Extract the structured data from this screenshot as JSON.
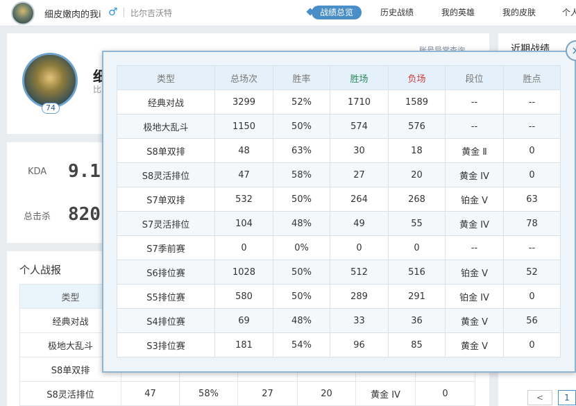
{
  "header": {
    "username": "细皮嫩肉的我i",
    "gender_symbol": "♂",
    "server": "比尔吉沃特",
    "nav": [
      "战绩总览",
      "历史战绩",
      "我的英雄",
      "我的皮肤",
      "个人"
    ]
  },
  "profile": {
    "name": "细",
    "sub": "比",
    "level": "74",
    "link": "账号异常查询"
  },
  "stats_summary": {
    "kda_label": "KDA",
    "kda_value": "9.1",
    "kills_label": "总击杀",
    "kills_value": "820"
  },
  "personal": {
    "title": "个人战报",
    "header_type": "类型",
    "rows": [
      [
        "经典对战",
        "",
        "",
        "",
        "",
        "",
        ""
      ],
      [
        "极地大乱斗",
        "",
        "",
        "",
        "",
        "",
        ""
      ],
      [
        "S8单双排",
        "",
        "",
        "",
        "",
        "",
        ""
      ],
      [
        "S8灵活排位",
        "47",
        "58%",
        "27",
        "20",
        "黄金 IV",
        "0"
      ]
    ]
  },
  "recent": {
    "title": "近期战绩"
  },
  "pager": {
    "prev": "<",
    "next": "1"
  },
  "popup": {
    "close": "×",
    "headers": [
      "类型",
      "总场次",
      "胜率",
      "胜场",
      "负场",
      "段位",
      "胜点"
    ],
    "rows": [
      [
        "经典对战",
        "3299",
        "52%",
        "1710",
        "1589",
        "--",
        "--"
      ],
      [
        "极地大乱斗",
        "1150",
        "50%",
        "574",
        "576",
        "--",
        "--"
      ],
      [
        "S8单双排",
        "48",
        "63%",
        "30",
        "18",
        "黄金 Ⅱ",
        "0"
      ],
      [
        "S8灵活排位",
        "47",
        "58%",
        "27",
        "20",
        "黄金 IV",
        "0"
      ],
      [
        "S7单双排",
        "532",
        "50%",
        "264",
        "268",
        "铂金 V",
        "63"
      ],
      [
        "S7灵活排位",
        "104",
        "48%",
        "49",
        "55",
        "黄金 IV",
        "78"
      ],
      [
        "S7季前赛",
        "0",
        "0%",
        "0",
        "0",
        "--",
        "--"
      ],
      [
        "S6排位赛",
        "1028",
        "50%",
        "512",
        "516",
        "铂金 V",
        "52"
      ],
      [
        "S5排位赛",
        "580",
        "50%",
        "289",
        "291",
        "铂金 IV",
        "0"
      ],
      [
        "S4排位赛",
        "69",
        "48%",
        "33",
        "36",
        "黄金 V",
        "56"
      ],
      [
        "S3排位赛",
        "181",
        "54%",
        "96",
        "85",
        "黄金 V",
        "0"
      ]
    ]
  }
}
